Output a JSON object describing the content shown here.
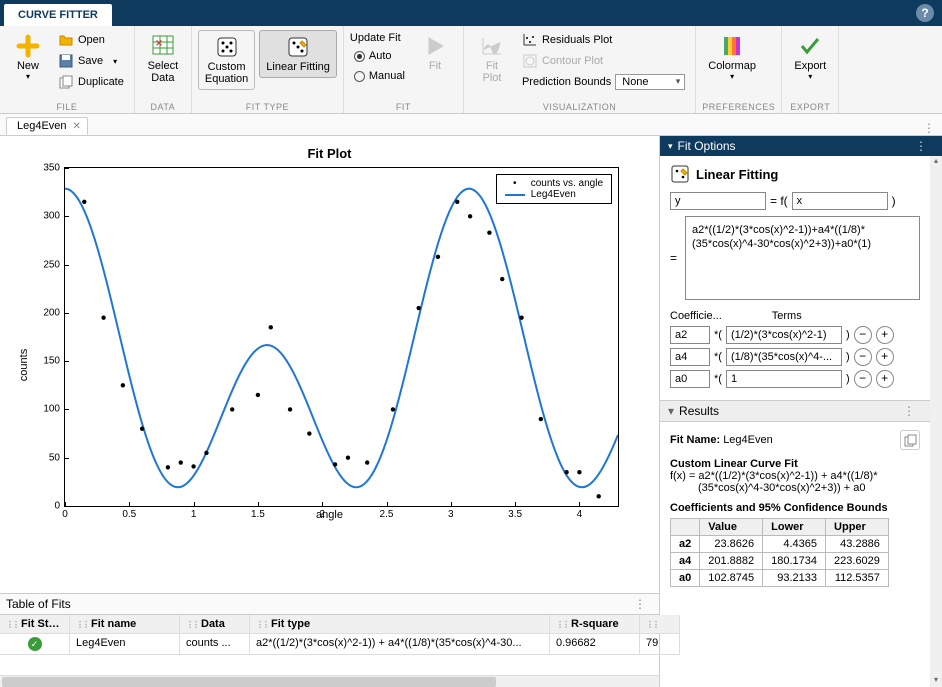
{
  "titleTab": "CURVE FITTER",
  "ribbon": {
    "file": {
      "new": "New",
      "open": "Open",
      "save": "Save",
      "duplicate": "Duplicate",
      "label": "FILE"
    },
    "data": {
      "select": "Select\nData",
      "label": "DATA"
    },
    "fitType": {
      "custom": "Custom\nEquation",
      "linear": "Linear Fitting",
      "label": "FIT TYPE"
    },
    "fit": {
      "update": "Update Fit",
      "auto": "Auto",
      "manual": "Manual",
      "fitBtn": "Fit",
      "label": "FIT"
    },
    "viz": {
      "fitPlot": "Fit\nPlot",
      "residuals": "Residuals Plot",
      "contour": "Contour Plot",
      "predBounds": "Prediction Bounds",
      "predValue": "None",
      "label": "VISUALIZATION"
    },
    "prefs": {
      "colormap": "Colormap",
      "label": "PREFERENCES"
    },
    "export": {
      "export": "Export",
      "label": "EXPORT"
    }
  },
  "docTab": "Leg4Even",
  "chart_data": {
    "type": "scatter+line",
    "title": "Fit Plot",
    "xlabel": "angle",
    "ylabel": "counts",
    "xlim": [
      0,
      4.3
    ],
    "ylim": [
      0,
      350
    ],
    "xticks": [
      0,
      0.5,
      1,
      1.5,
      2,
      2.5,
      3,
      3.5,
      4
    ],
    "yticks": [
      0,
      50,
      100,
      150,
      200,
      250,
      300,
      350
    ],
    "legend": [
      "counts vs. angle",
      "Leg4Even"
    ],
    "scatter": {
      "x": [
        0.15,
        0.3,
        0.45,
        0.6,
        0.8,
        0.9,
        1.0,
        1.1,
        1.3,
        1.5,
        1.6,
        1.75,
        1.9,
        2.1,
        2.2,
        2.35,
        2.55,
        2.75,
        2.9,
        3.05,
        3.15,
        3.3,
        3.4,
        3.55,
        3.7,
        3.9,
        4.0,
        4.15
      ],
      "y": [
        315,
        195,
        125,
        80,
        40,
        45,
        41,
        55,
        100,
        115,
        185,
        100,
        75,
        43,
        50,
        45,
        100,
        205,
        258,
        315,
        300,
        283,
        235,
        195,
        90,
        35,
        35,
        10
      ]
    },
    "fit_curve": "a2*((1/2)*(3*cos(x)^2-1)) + a4*((1/8)*(35*cos(x)^4-30*cos(x)^2+3)) + a0*(1)",
    "fit_params": {
      "a2": 23.8626,
      "a4": 201.8882,
      "a0": 102.8745
    }
  },
  "tableOfFits": {
    "title": "Table of Fits",
    "headers": [
      "Fit State",
      "Fit name",
      "Data",
      "Fit type",
      "R-square",
      ""
    ],
    "row": {
      "fitName": "Leg4Even",
      "data": "counts ...",
      "fitType": "a2*((1/2)*(3*cos(x)^2-1)) + a4*((1/8)*(35*cos(x)^4-30...",
      "rsquare": "0.96682",
      "extra": "79"
    }
  },
  "fitOptions": {
    "panelTitle": "Fit Options",
    "method": "Linear Fitting",
    "yVar": "y",
    "xVar": "x",
    "equation": "a2*((1/2)*(3*cos(x)^2-1))+a4*((1/8)*(35*cos(x)^4-30*cos(x)^2+3))+a0*(1)",
    "coefLabel": "Coefficie...",
    "termLabel": "Terms",
    "coefs": [
      {
        "name": "a2",
        "term": "(1/2)*(3*cos(x)^2-1)"
      },
      {
        "name": "a4",
        "term": "(1/8)*(35*cos(x)^4-..."
      },
      {
        "name": "a0",
        "term": "1"
      }
    ]
  },
  "results": {
    "panelTitle": "Results",
    "fitNameLabel": "Fit Name:",
    "fitName": "Leg4Even",
    "typeLine": "Custom Linear Curve Fit",
    "fxLine": "f(x) = a2*((1/2)*(3*cos(x)^2-1)) + a4*((1/8)*",
    "fxLine2": "(35*cos(x)^4-30*cos(x)^2+3)) + a0",
    "boundsTitle": "Coefficients and 95% Confidence Bounds",
    "headers": [
      "",
      "Value",
      "Lower",
      "Upper"
    ],
    "rows": [
      [
        "a2",
        "23.8626",
        "4.4365",
        "43.2886"
      ],
      [
        "a4",
        "201.8882",
        "180.1734",
        "223.6029"
      ],
      [
        "a0",
        "102.8745",
        "93.2133",
        "112.5357"
      ]
    ]
  }
}
